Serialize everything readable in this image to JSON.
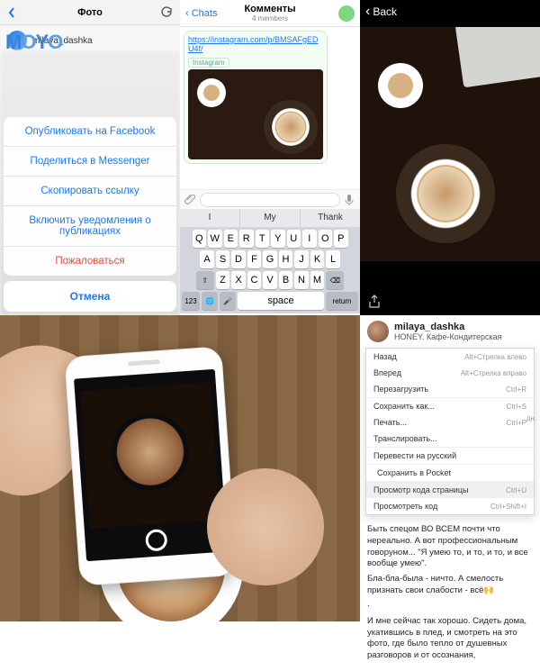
{
  "p1": {
    "nav_title": "Фото",
    "username": "milaya_dashka",
    "logo1": "M",
    "logo2": "O",
    "logo3": "Y",
    "logo4": "O",
    "actions": {
      "facebook": "Опубликовать на Facebook",
      "messenger": "Поделиться в Messenger",
      "copy": "Скопировать ссылку",
      "notif": "Включить уведомления о публикациях",
      "report": "Пожаловаться",
      "cancel": "Отмена"
    }
  },
  "p2": {
    "back": "Chats",
    "title": "Комменты",
    "subtitle": "4 members",
    "link_text": "https://instagram.com/p/BMSAFgEDU4f/",
    "preview_source": "Instagram",
    "suggestions": [
      "I",
      "My",
      "Thank"
    ],
    "rows": [
      [
        "Q",
        "W",
        "E",
        "R",
        "T",
        "Y",
        "U",
        "I",
        "O",
        "P"
      ],
      [
        "A",
        "S",
        "D",
        "F",
        "G",
        "H",
        "J",
        "K",
        "L"
      ],
      [
        "Z",
        "X",
        "C",
        "V",
        "B",
        "N",
        "M"
      ]
    ],
    "fn": {
      "shift": "⇧",
      "bksp": "⌫",
      "num": "123",
      "globe": "🌐",
      "space": "space",
      "return": "return",
      "mic": "🎤"
    }
  },
  "p3": {
    "back": "Back"
  },
  "p5": {
    "username": "milaya_dashka",
    "location": "HONEY. Кафе-Кондитерская",
    "menu": [
      {
        "label": "Назад",
        "shortcut": "Alt+Стрелка влево"
      },
      {
        "label": "Вперед",
        "shortcut": "Alt+Стрелка вправо"
      },
      {
        "label": "Перезагрузить",
        "shortcut": "Ctrl+R"
      },
      {
        "label": "Сохранить как...",
        "shortcut": "Ctrl+S",
        "sep": true
      },
      {
        "label": "Печать...",
        "shortcut": "Ctrl+P"
      },
      {
        "label": "Транслировать...",
        "shortcut": ""
      },
      {
        "label": "Перевести на русский",
        "shortcut": "",
        "sep": true
      },
      {
        "label": "Сохранить в Pocket",
        "shortcut": "",
        "sep": true,
        "pocket": true
      },
      {
        "label": "Просмотр кода страницы",
        "shortcut": "Ctrl+U",
        "sep": true,
        "hl": true
      },
      {
        "label": "Просмотреть код",
        "shortcut": "Ctrl+Shift+I"
      }
    ],
    "caption": {
      "l1": "Быть спецом ВО ВСЕМ почти что нереально. А вот профессиональным говоруном... \"Я умею то, и то, и то, и все вообще умею\".",
      "l2": "Бла-бла-была - ничто. А смелость признать свои слабости - всё🙌",
      "l3": "И мне сейчас так хорошо. Сидеть дома, укатившись в плед, и смотреть на это фото, где было тепло от душевных разговоров и от осознания,"
    },
    "aside": "дн."
  }
}
